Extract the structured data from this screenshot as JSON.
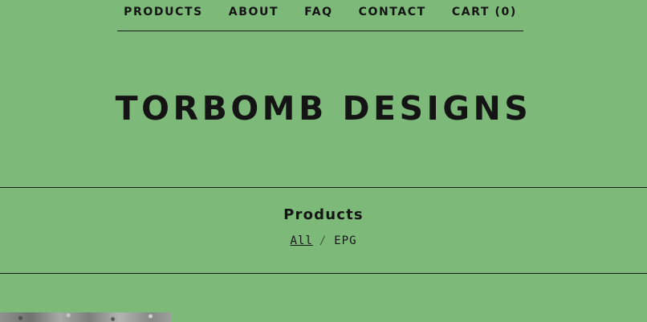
{
  "nav": {
    "items": [
      {
        "label": "PRODUCTS"
      },
      {
        "label": "ABOUT"
      },
      {
        "label": "FAQ"
      },
      {
        "label": "CONTACT"
      },
      {
        "label": "CART (0)"
      }
    ]
  },
  "site": {
    "title": "TORBOMB DESIGNS"
  },
  "products": {
    "heading": "Products",
    "categories": [
      {
        "label": "All",
        "active": true
      },
      {
        "label": "EPG",
        "active": false
      }
    ],
    "separator": "/"
  },
  "colors": {
    "background": "#7dba7a",
    "text": "#141414"
  }
}
